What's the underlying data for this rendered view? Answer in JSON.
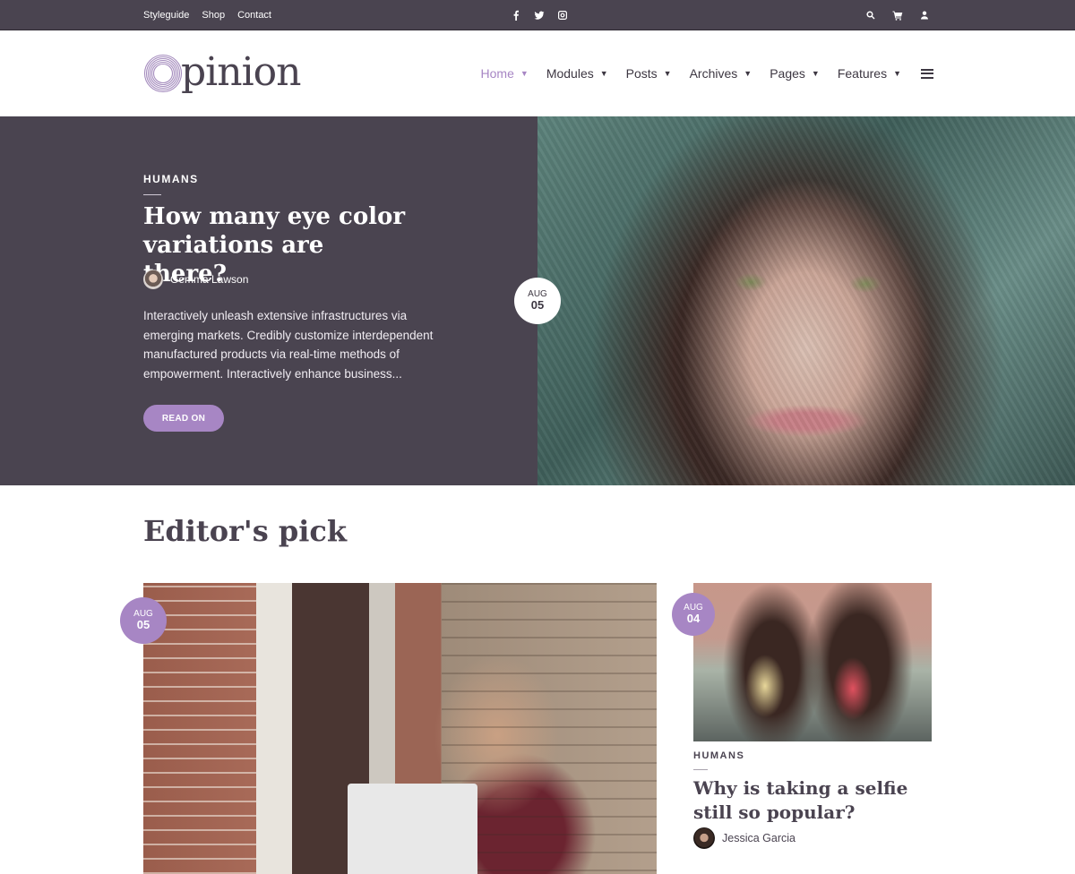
{
  "topbar": {
    "links": [
      "Styleguide",
      "Shop",
      "Contact"
    ],
    "social": [
      "facebook-icon",
      "twitter-icon",
      "instagram-icon"
    ],
    "tools": [
      "search-icon",
      "cart-icon",
      "user-icon"
    ]
  },
  "header": {
    "logo_text": "pinion",
    "nav": [
      {
        "label": "Home",
        "active": true
      },
      {
        "label": "Modules"
      },
      {
        "label": "Posts"
      },
      {
        "label": "Archives"
      },
      {
        "label": "Pages"
      },
      {
        "label": "Features"
      }
    ],
    "caret": "▼"
  },
  "hero": {
    "category": "HUMANS",
    "title": "How many eye color variations are there?",
    "author": "Gemma Lawson",
    "excerpt": "Interactively unleash extensive infrastructures via emerging markets. Credibly customize interdependent manufactured products via real-time methods of empowerment. Interactively enhance business...",
    "button": "READ ON",
    "date": {
      "month": "AUG",
      "day": "05"
    }
  },
  "editors_pick": {
    "title": "Editor's pick",
    "main": {
      "date": {
        "month": "AUG",
        "day": "05"
      }
    },
    "side": {
      "date": {
        "month": "AUG",
        "day": "04"
      },
      "category": "HUMANS",
      "title": "Why is taking a selfie still so popular?",
      "author": "Jessica Garcia"
    }
  },
  "colors": {
    "accent": "#a786c4",
    "dark": "#4a4450",
    "text": "#4a4350"
  }
}
